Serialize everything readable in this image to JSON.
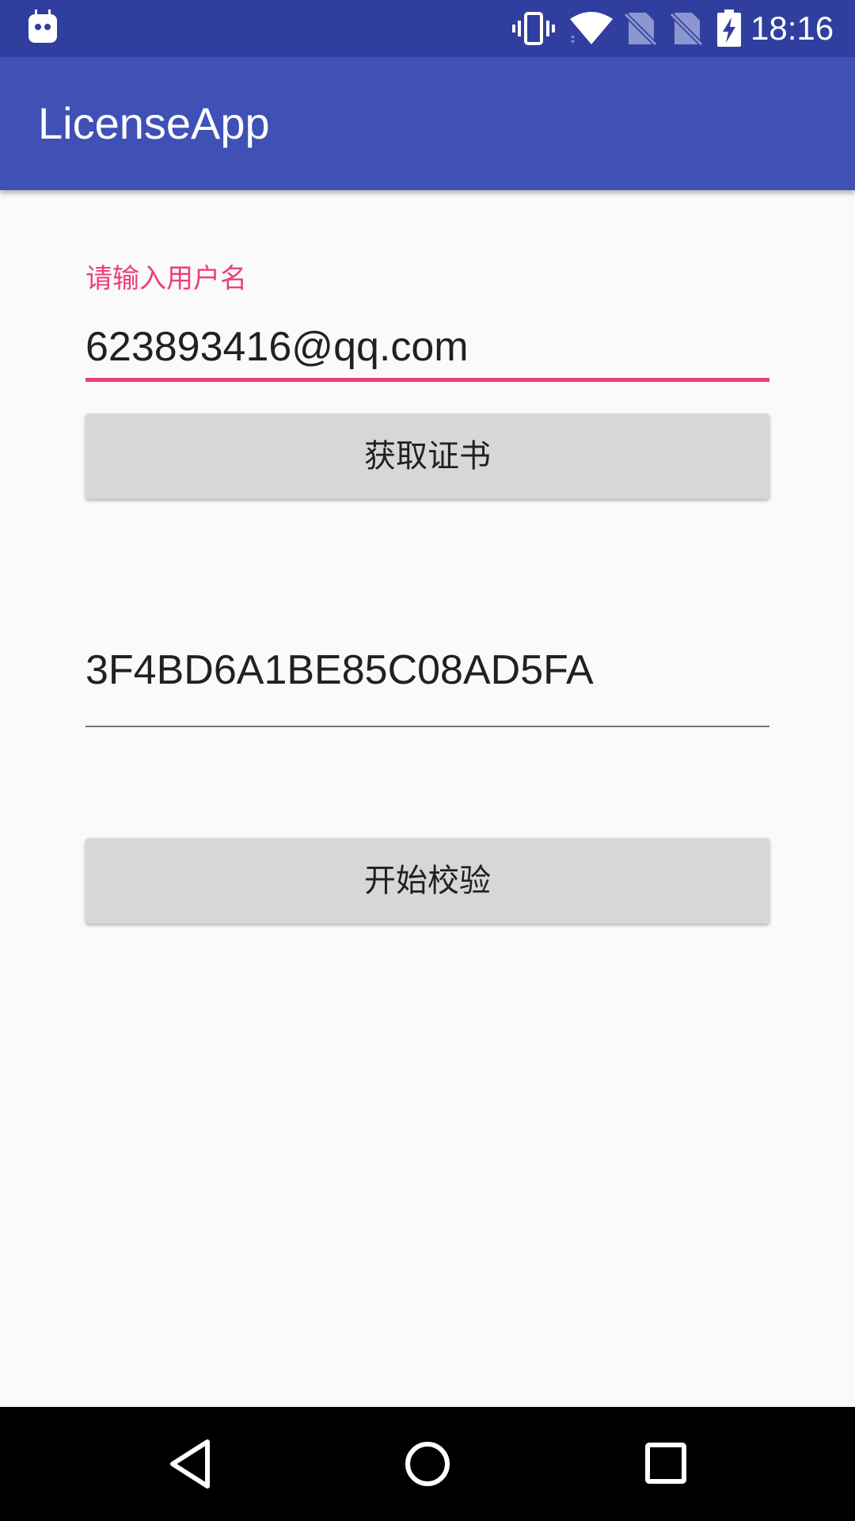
{
  "status_bar": {
    "time": "18:16",
    "icons": [
      "android-icon",
      "vibrate-icon",
      "wifi-icon",
      "no-sim-icon",
      "no-sim-icon",
      "battery-charging-icon"
    ]
  },
  "app_bar": {
    "title": "LicenseApp"
  },
  "form": {
    "username_label": "请输入用户名",
    "username_value": "623893416@qq.com",
    "get_license_label": "获取证书",
    "license_value": "3F4BD6A1BE85C08AD5FA",
    "start_verify_label": "开始校验"
  },
  "nav_bar": {
    "icons": [
      "back-icon",
      "home-icon",
      "recents-icon"
    ]
  },
  "colors": {
    "status_bar": "#303F9F",
    "app_bar": "#3F51B5",
    "accent": "#EC407A",
    "button": "#D6D7D7",
    "background": "#FAFAFA"
  }
}
